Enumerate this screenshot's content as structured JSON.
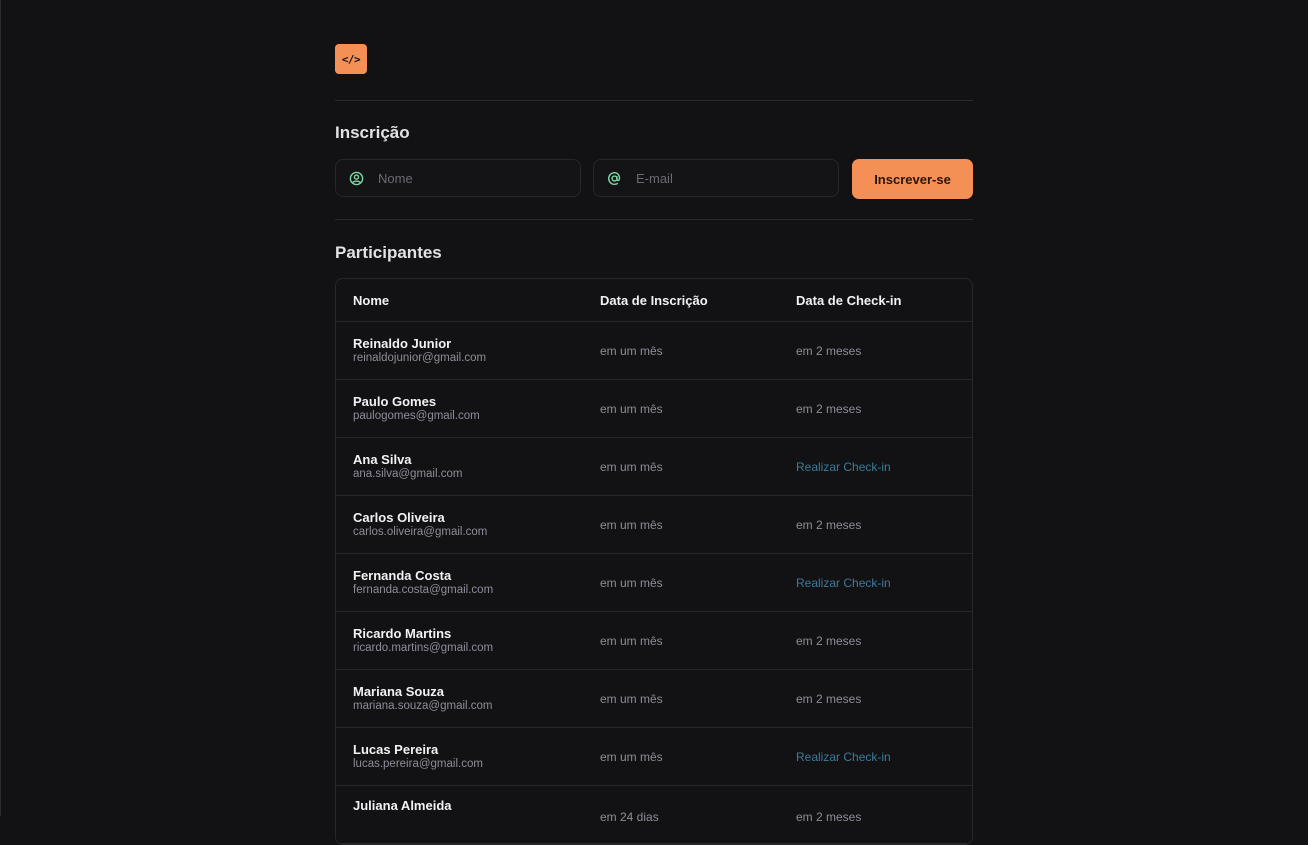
{
  "logo": {
    "text": "</>"
  },
  "signup": {
    "title": "Inscrição",
    "name_placeholder": "Nome",
    "email_placeholder": "E-mail",
    "button_label": "Inscrever-se"
  },
  "participants": {
    "title": "Participantes",
    "columns": [
      "Nome",
      "Data de Inscrição",
      "Data de Check-in"
    ],
    "rows": [
      {
        "name": "Reinaldo Junior",
        "email": "reinaldojunior@gmail.com",
        "subscribed": "em um mês",
        "checkin": "em 2 meses",
        "checkin_is_action": false
      },
      {
        "name": "Paulo Gomes",
        "email": "paulogomes@gmail.com",
        "subscribed": "em um mês",
        "checkin": "em 2 meses",
        "checkin_is_action": false
      },
      {
        "name": "Ana Silva",
        "email": "ana.silva@gmail.com",
        "subscribed": "em um mês",
        "checkin": "Realizar Check-in",
        "checkin_is_action": true
      },
      {
        "name": "Carlos Oliveira",
        "email": "carlos.oliveira@gmail.com",
        "subscribed": "em um mês",
        "checkin": "em 2 meses",
        "checkin_is_action": false
      },
      {
        "name": "Fernanda Costa",
        "email": "fernanda.costa@gmail.com",
        "subscribed": "em um mês",
        "checkin": "Realizar Check-in",
        "checkin_is_action": true
      },
      {
        "name": "Ricardo Martins",
        "email": "ricardo.martins@gmail.com",
        "subscribed": "em um mês",
        "checkin": "em 2 meses",
        "checkin_is_action": false
      },
      {
        "name": "Mariana Souza",
        "email": "mariana.souza@gmail.com",
        "subscribed": "em um mês",
        "checkin": "em 2 meses",
        "checkin_is_action": false
      },
      {
        "name": "Lucas Pereira",
        "email": "lucas.pereira@gmail.com",
        "subscribed": "em um mês",
        "checkin": "Realizar Check-in",
        "checkin_is_action": true
      },
      {
        "name": "Juliana Almeida",
        "email": "",
        "subscribed": "em 24 dias",
        "checkin": "em 2 meses",
        "checkin_is_action": false
      }
    ]
  },
  "colors": {
    "background": "#121214",
    "accent": "#f48f56",
    "icon_green": "#7fd6a4",
    "link": "#3d7a99"
  },
  "icons": {
    "name_field": "user-circle-icon",
    "email_field": "at-sign-icon"
  }
}
